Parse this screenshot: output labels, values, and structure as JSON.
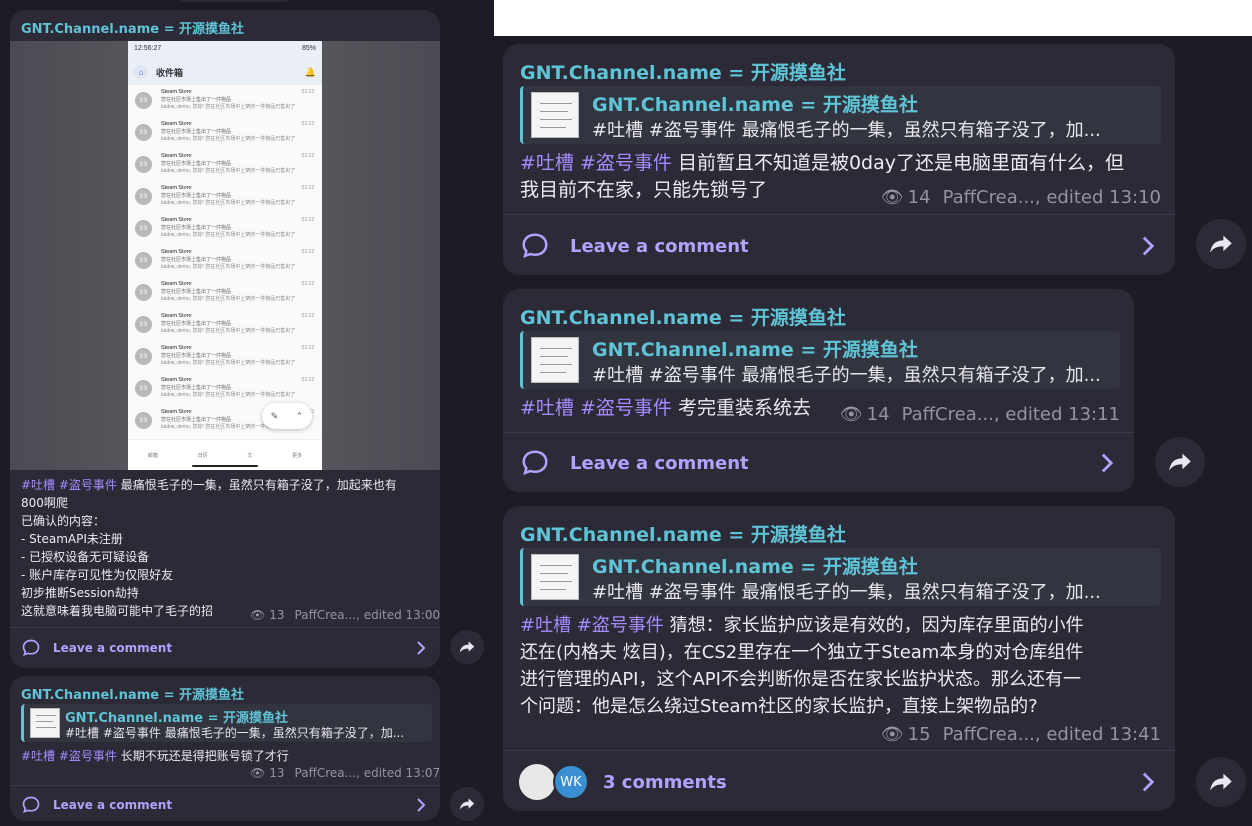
{
  "channel_name": "GNT.Channel.name = 开源摸鱼社",
  "quote_preview": "#吐槽 #盗号事件 最痛恨毛子的一集，虽然只有箱子没了，加...",
  "leave_comment": "Leave a comment",
  "left_post_1": {
    "tags": "#吐槽 #盗号事件",
    "lines": [
      "最痛恨毛子的一集，虽然只有箱子没了，加起来也有",
      "800啊爬",
      "已确认的内容：",
      "- SteamAPI未注册",
      "- 已授权设备无可疑设备",
      "- 账户库存可见性为仅限好友",
      "初步推断Session劫持",
      "这就意味着我电脑可能中了毛子的招"
    ],
    "views": "13",
    "meta": "PaffCrea..., edited 13:00",
    "phone": {
      "status_time": "12:56:27",
      "status_right": "85%",
      "title": "收件箱",
      "items": [
        {
          "sender": "Steam Store",
          "time": "03:23",
          "line1": "您在社区市场上售出了一件物品",
          "line2": "baibai_demo, 您好! 您在社区市场中上架的一件物品已售出了"
        },
        {
          "sender": "Steam Store",
          "time": "03:23",
          "line1": "您在社区市场上售出了一件物品",
          "line2": "baibai_demo, 您好! 您在社区市场中上架的一件物品已售出了"
        },
        {
          "sender": "Steam Store",
          "time": "03:22",
          "line1": "您在社区市场上售出了一件物品",
          "line2": "baibai_demo, 您好! 您在社区市场中上架的一件物品已售出了"
        },
        {
          "sender": "Steam Store",
          "time": "03:22",
          "line1": "您在社区市场上售出了一件物品",
          "line2": "baibai_demo, 您好! 您在社区市场中上架的一件物品已售出了"
        },
        {
          "sender": "Steam Store",
          "time": "03:22",
          "line1": "您在社区市场上售出了一件物品",
          "line2": "baibai_demo, 您好! 您在社区市场中上架的一件物品已售出了"
        },
        {
          "sender": "Steam Store",
          "time": "03:22",
          "line1": "您在社区市场上售出了一件物品",
          "line2": "baibai_demo, 您好! 您在社区市场中上架的一件物品已售出了"
        },
        {
          "sender": "Steam Store",
          "time": "03:22",
          "line1": "您在社区市场上售出了一件物品",
          "line2": "baibai_demo, 您好! 您在社区市场中上架的一件物品已售出了"
        },
        {
          "sender": "Steam Store",
          "time": "03:22",
          "line1": "您在社区市场上售出了一件物品",
          "line2": "baibai_demo, 您好! 您在社区市场中上架的一件物品已售出了"
        },
        {
          "sender": "Steam Store",
          "time": "03:22",
          "line1": "您在社区市场上售出了一件物品",
          "line2": "baibai_demo, 您好! 您在社区市场中上架的一件物品已售出了"
        },
        {
          "sender": "Steam Store",
          "time": "03:22",
          "line1": "您在社区市场上售出了一件物品",
          "line2": "baibai_demo, 您好! 您在社区市场中上架的一件物品已售出了"
        },
        {
          "sender": "Steam Store",
          "time": "03:22",
          "line1": "您在社区市场上售出了一件物品",
          "line2": "baibai_demo, 您好! 您在社区市场中上架的一件物品已售出了"
        }
      ],
      "nav": [
        "邮箱",
        "日历",
        "文",
        "更多"
      ]
    }
  },
  "left_post_2": {
    "tags": "#吐槽 #盗号事件",
    "text": "长期不玩还是得把账号锁了才行",
    "views": "13",
    "meta": "PaffCrea..., edited 13:07"
  },
  "right_post_1": {
    "tags": "#吐槽 #盗号事件",
    "lines": [
      "目前暂且不知道是被0day了还是电脑里面有什么，但",
      "我目前不在家，只能先锁号了"
    ],
    "views": "14",
    "meta": "PaffCrea..., edited 13:10"
  },
  "right_post_2": {
    "tags": "#吐槽 #盗号事件",
    "text": "考完重装系统去",
    "views": "14",
    "meta": "PaffCrea..., edited 13:11"
  },
  "right_post_3": {
    "tags": "#吐槽 #盗号事件",
    "lines": [
      "猜想：家长监护应该是有效的，因为库存里面的小件",
      "还在(内格夫 炫目)，在CS2里存在一个独立于Steam本身的对仓库组件",
      "进行管理的API，这个API不会判断你是否在家长监护状态。那么还有一",
      "个问题：他是怎么绕过Steam社区的家长监护，直接上架物品的?"
    ],
    "views": "15",
    "meta": "PaffCrea..., edited 13:41",
    "comments_label": "3 comments",
    "avatar_initials": "WK"
  }
}
